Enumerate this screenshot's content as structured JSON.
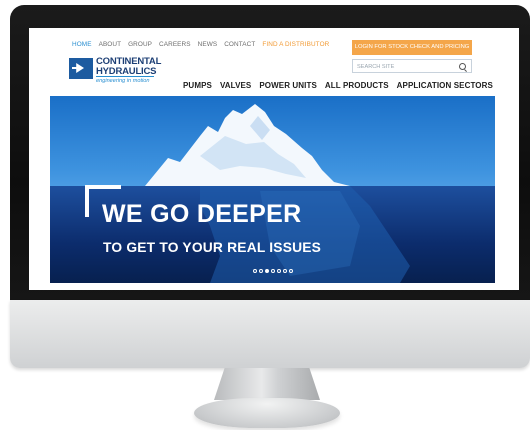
{
  "site": {
    "top_nav": [
      {
        "label": "HOME",
        "active": true
      },
      {
        "label": "ABOUT"
      },
      {
        "label": "GROUP"
      },
      {
        "label": "CAREERS"
      },
      {
        "label": "NEWS"
      },
      {
        "label": "CONTACT"
      },
      {
        "label": "FIND A DISTRIBUTOR",
        "highlight": true
      }
    ],
    "login_button": "LOGIN FOR STOCK CHECK AND PRICING",
    "search": {
      "placeholder": "SEARCH SITE",
      "icon": "search-icon"
    },
    "logo": {
      "line1": "CONTINENTAL",
      "line2": "HYDRAULICS",
      "tagline": "engineering in motion",
      "icon": "arrow-logo-icon"
    },
    "main_nav": [
      "PUMPS",
      "VALVES",
      "POWER UNITS",
      "ALL PRODUCTS",
      "APPLICATION SECTORS"
    ],
    "hero": {
      "title": "WE GO DEEPER",
      "subtitle": "TO GET TO YOUR REAL ISSUES",
      "slide_count": 7,
      "active_slide": 3
    },
    "colors": {
      "accent_blue": "#2a8fd1",
      "accent_orange": "#f4a64a",
      "logo_navy": "#1d3f75"
    }
  }
}
